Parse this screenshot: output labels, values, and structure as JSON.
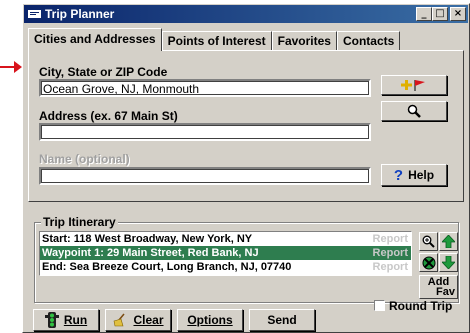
{
  "window": {
    "title": "Trip Planner",
    "controls": {
      "minimize": "_",
      "maximize": "□",
      "close": "×"
    }
  },
  "tabs": [
    {
      "label": "Cities and Addresses",
      "active": true
    },
    {
      "label": "Points of Interest",
      "active": false
    },
    {
      "label": "Favorites",
      "active": false
    },
    {
      "label": "Contacts",
      "active": false
    }
  ],
  "form": {
    "city_label": "City, State or ZIP Code",
    "city_value": "Ocean Grove, NJ, Monmouth",
    "address_label": "Address (ex. 67 Main St)",
    "address_value": "",
    "name_label": "Name (optional)",
    "name_value": ""
  },
  "buttons": {
    "help": "Help",
    "run": "Run",
    "clear": "Clear",
    "options": "Options",
    "send": "Send",
    "add_fav_line1": "Add",
    "add_fav_line2": "Fav"
  },
  "itinerary": {
    "title": "Trip Itinerary",
    "rows": [
      {
        "text": "Start: 118 West Broadway, New York, NY",
        "report": "Report",
        "selected": false
      },
      {
        "text": "Waypoint 1: 29 Main Street, Red Bank, NJ",
        "report": "Report",
        "selected": true
      },
      {
        "text": "End: Sea Breeze Court, Long Branch, NJ, 07740",
        "report": "Report",
        "selected": false
      }
    ],
    "round_trip_label": "Round Trip",
    "round_trip_checked": false
  },
  "colors": {
    "selection": "#2e7d4f",
    "pointer_arrow": "#d8141c",
    "titlebar": "#0a246a"
  }
}
